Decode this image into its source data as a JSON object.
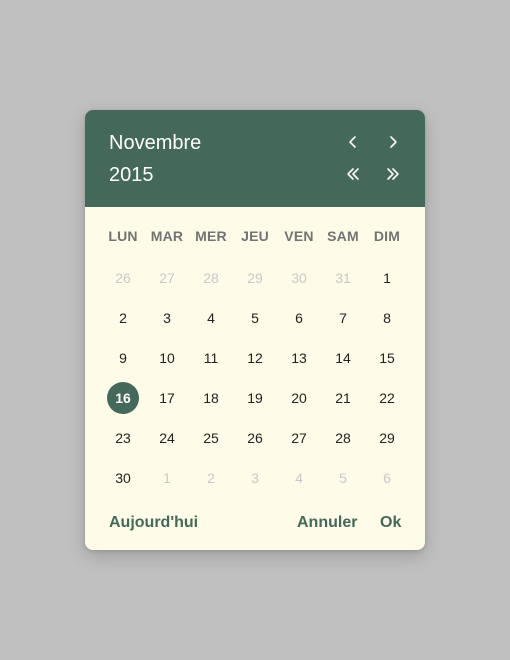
{
  "header": {
    "month": "Novembre",
    "year": "2015"
  },
  "nav": {
    "prev_month_icon": "chevron-left-icon",
    "next_month_icon": "chevron-right-icon",
    "prev_year_icon": "double-chevron-left-icon",
    "next_year_icon": "double-chevron-right-icon"
  },
  "weekdays": [
    "LUN",
    "MAR",
    "MER",
    "JEU",
    "VEN",
    "SAM",
    "DIM"
  ],
  "days": [
    {
      "label": "26",
      "muted": true
    },
    {
      "label": "27",
      "muted": true
    },
    {
      "label": "28",
      "muted": true
    },
    {
      "label": "29",
      "muted": true
    },
    {
      "label": "30",
      "muted": true
    },
    {
      "label": "31",
      "muted": true
    },
    {
      "label": "1"
    },
    {
      "label": "2"
    },
    {
      "label": "3"
    },
    {
      "label": "4"
    },
    {
      "label": "5"
    },
    {
      "label": "6"
    },
    {
      "label": "7"
    },
    {
      "label": "8"
    },
    {
      "label": "9"
    },
    {
      "label": "10"
    },
    {
      "label": "11"
    },
    {
      "label": "12"
    },
    {
      "label": "13"
    },
    {
      "label": "14"
    },
    {
      "label": "15"
    },
    {
      "label": "16",
      "selected": true
    },
    {
      "label": "17"
    },
    {
      "label": "18"
    },
    {
      "label": "19"
    },
    {
      "label": "20"
    },
    {
      "label": "21"
    },
    {
      "label": "22"
    },
    {
      "label": "23"
    },
    {
      "label": "24"
    },
    {
      "label": "25"
    },
    {
      "label": "26"
    },
    {
      "label": "27"
    },
    {
      "label": "28"
    },
    {
      "label": "29"
    },
    {
      "label": "30"
    },
    {
      "label": "1",
      "muted": true
    },
    {
      "label": "2",
      "muted": true
    },
    {
      "label": "3",
      "muted": true
    },
    {
      "label": "4",
      "muted": true
    },
    {
      "label": "5",
      "muted": true
    },
    {
      "label": "6",
      "muted": true
    }
  ],
  "footer": {
    "today_label": "Aujourd'hui",
    "cancel_label": "Annuler",
    "ok_label": "Ok"
  },
  "colors": {
    "accent": "#44695a",
    "surface": "#fefbe8",
    "backdrop": "#c0c0c0"
  }
}
